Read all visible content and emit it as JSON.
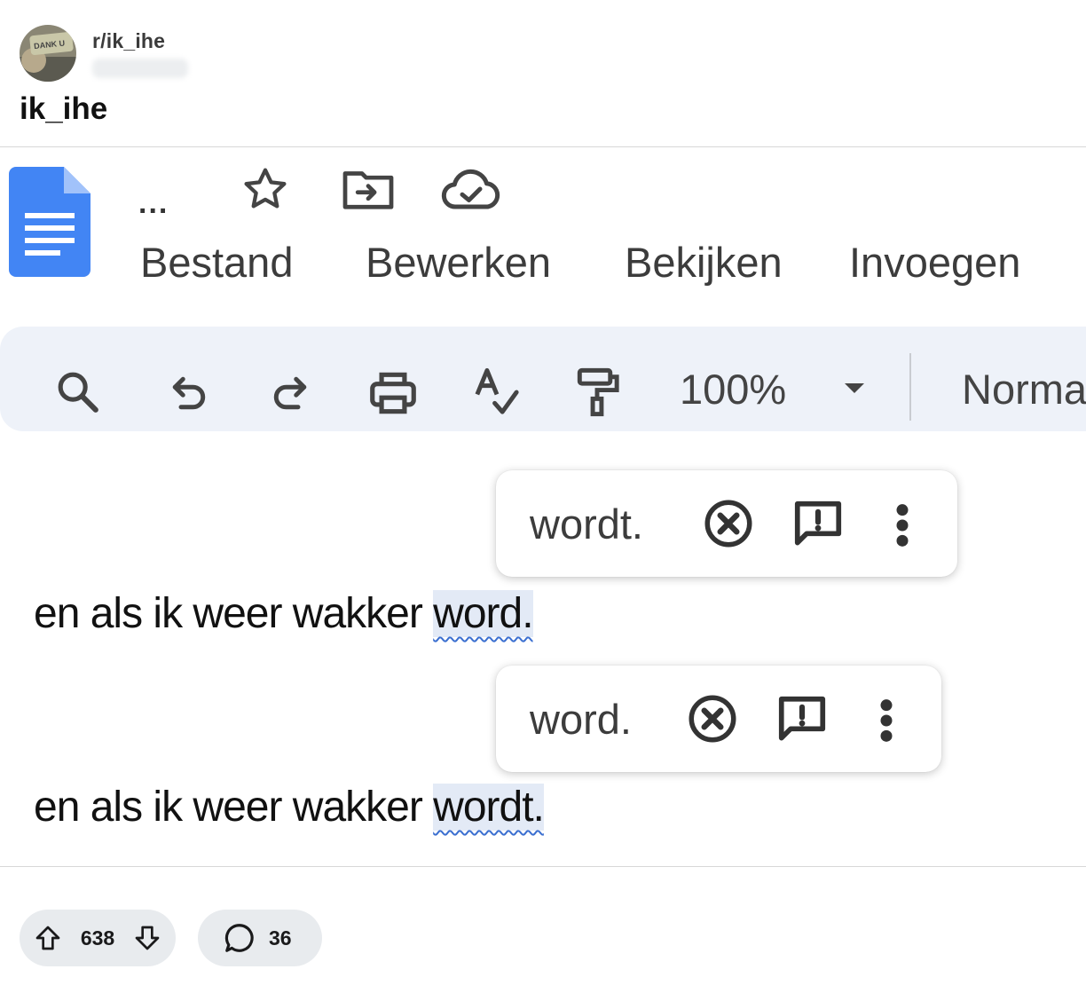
{
  "post": {
    "subreddit": "r/ik_ihe",
    "avatar_text": "DANK U",
    "title": "ik_ihe"
  },
  "docs": {
    "title_ellipsis": "...",
    "menu": [
      "Bestand",
      "Bewerken",
      "Bekijken",
      "Invoegen"
    ],
    "zoom": "100%",
    "style": "Normal"
  },
  "suggestions": [
    {
      "replacement": "wordt."
    },
    {
      "replacement": "word."
    }
  ],
  "lines": [
    {
      "prefix": "en als ik weer wakker ",
      "flagged": "word."
    },
    {
      "prefix": "en als ik weer wakker ",
      "flagged": "wordt."
    }
  ],
  "stats": {
    "upvotes": "638",
    "comments": "36"
  },
  "colors": {
    "docs_blue": "#4285f4",
    "toolbar_bg": "#eef2f9",
    "spell_underline": "#3b6fd0"
  }
}
